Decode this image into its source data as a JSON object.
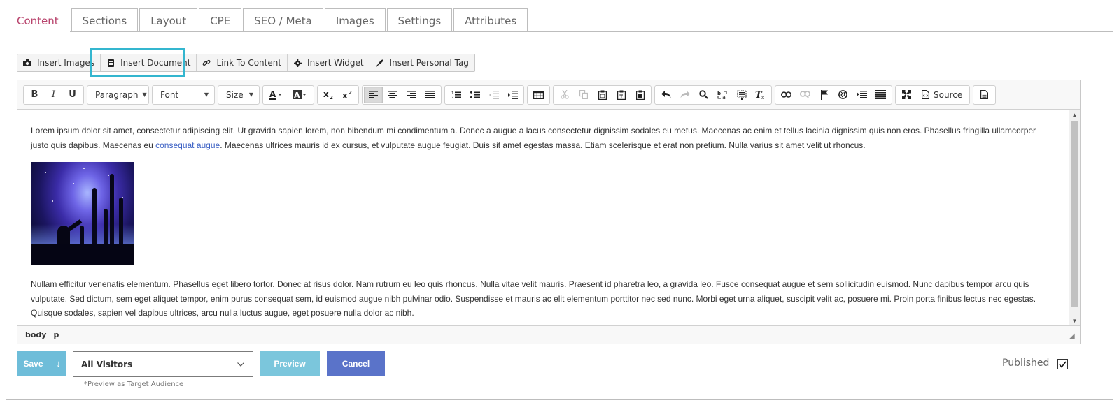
{
  "tabs": [
    {
      "label": "Content",
      "active": true
    },
    {
      "label": "Sections"
    },
    {
      "label": "Layout"
    },
    {
      "label": "CPE"
    },
    {
      "label": "SEO / Meta"
    },
    {
      "label": "Images"
    },
    {
      "label": "Settings"
    },
    {
      "label": "Attributes"
    }
  ],
  "insert_toolbar": {
    "insert_images": {
      "label": "Insert Images",
      "icon": "camera-icon"
    },
    "insert_document": {
      "label": "Insert Document",
      "icon": "document-icon"
    },
    "link_to_content": {
      "label": "Link To Content",
      "icon": "link-icon"
    },
    "insert_widget": {
      "label": "Insert Widget",
      "icon": "gear-icon"
    },
    "insert_personal_tag": {
      "label": "Insert Personal Tag",
      "icon": "tag-icon"
    }
  },
  "editor_toolbar": {
    "bold": "B",
    "italic": "I",
    "underline": "U",
    "paragraph": "Paragraph",
    "font": "Font",
    "size": "Size",
    "source": "Source"
  },
  "editor": {
    "paragraph1_before_link": "Lorem ipsum dolor sit amet, consectetur adipiscing elit. Ut gravida sapien lorem, non bibendum mi condimentum a. Donec a augue a lacus consectetur dignissim sodales eu metus. Maecenas ac enim et tellus lacinia dignissim quis non eros. Phasellus fringilla ullamcorper justo quis dapibus. Maecenas eu ",
    "paragraph1_link": "consequat augue",
    "paragraph1_after_link": ". Maecenas ultrices mauris id ex cursus, et vulputate augue feugiat. Duis sit amet egestas massa. Etiam scelerisque et erat non pretium. Nulla varius sit amet velit ut rhoncus.",
    "paragraph2": "Nullam efficitur venenatis elementum. Phasellus eget libero tortor. Donec at risus dolor. Nam rutrum eu leo quis rhoncus. Nulla vitae velit mauris. Praesent id pharetra leo, a gravida leo. Fusce consequat augue et sem sollicitudin euismod. Nunc dapibus tempor arcu quis vulputate. Sed dictum, sem eget aliquet tempor, enim purus consequat sem, id euismod augue nibh pulvinar odio. Suspendisse et mauris ac elit elementum porttitor nec sed nunc. Morbi eget urna aliquet, suscipit velit ac, posuere mi. Proin porta finibus lectus nec egestas. Quisque sodales, sapien vel dapibus ultrices, arcu nulla luctus augue, eget posuere nulla dolor ac nibh.",
    "path": [
      "body",
      "p"
    ]
  },
  "footer": {
    "save": "Save",
    "save_dropdown": "↓",
    "audience": "All Visitors",
    "audience_hint": "*Preview as Target Audience",
    "preview": "Preview",
    "cancel": "Cancel",
    "published_label": "Published",
    "published_checked": true
  },
  "colors": {
    "active_tab": "#b8436c",
    "highlight": "#34b6cf",
    "save": "#6ebdd9",
    "preview": "#7bc6dc",
    "cancel": "#5a73c9",
    "link": "#3b60c4"
  }
}
